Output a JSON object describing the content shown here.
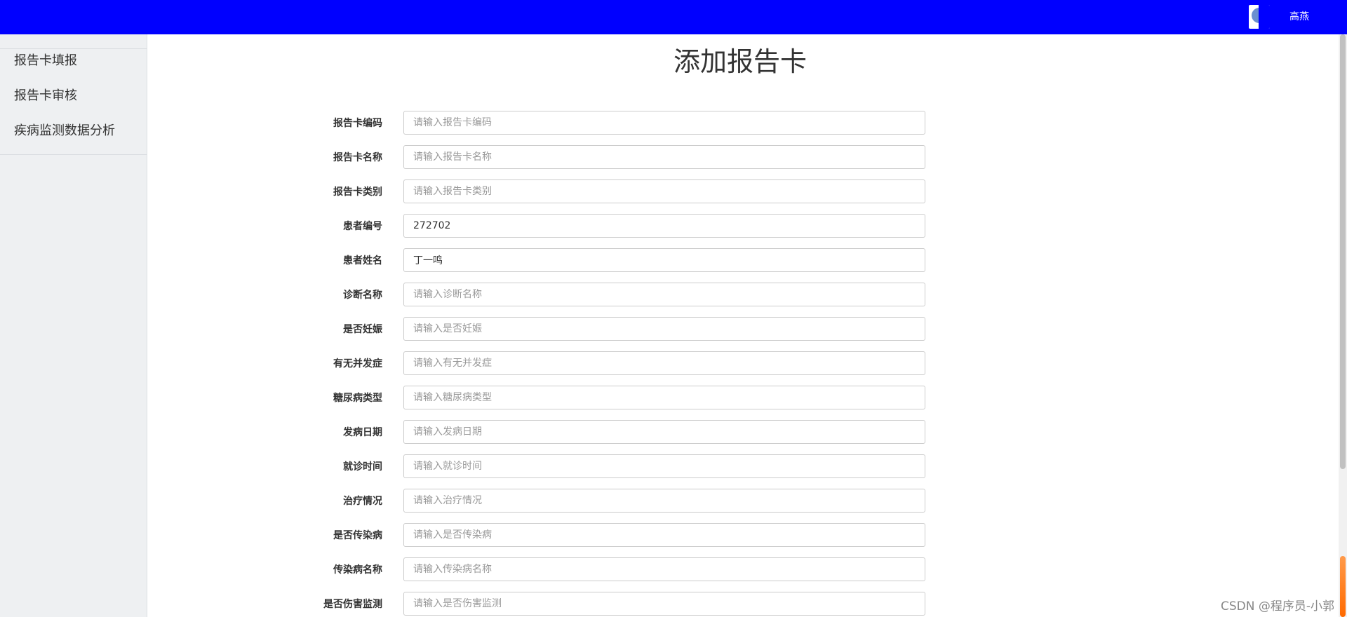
{
  "header": {
    "username": "高燕",
    "avatar_icon": "user-avatar-image",
    "bg_color": "#0000ff"
  },
  "sidebar": {
    "items": [
      {
        "label": "报告卡填报"
      },
      {
        "label": "报告卡审核"
      },
      {
        "label": "疾病监测数据分析"
      }
    ]
  },
  "main": {
    "title": "添加报告卡",
    "fields": [
      {
        "label": "报告卡编码",
        "value": "",
        "placeholder": "请输入报告卡编码"
      },
      {
        "label": "报告卡名称",
        "value": "",
        "placeholder": "请输入报告卡名称"
      },
      {
        "label": "报告卡类别",
        "value": "",
        "placeholder": "请输入报告卡类别"
      },
      {
        "label": "患者编号",
        "value": "272702",
        "placeholder": ""
      },
      {
        "label": "患者姓名",
        "value": "丁一鸣",
        "placeholder": ""
      },
      {
        "label": "诊断名称",
        "value": "",
        "placeholder": "请输入诊断名称"
      },
      {
        "label": "是否妊娠",
        "value": "",
        "placeholder": "请输入是否妊娠"
      },
      {
        "label": "有无并发症",
        "value": "",
        "placeholder": "请输入有无并发症"
      },
      {
        "label": "糖尿病类型",
        "value": "",
        "placeholder": "请输入糖尿病类型"
      },
      {
        "label": "发病日期",
        "value": "",
        "placeholder": "请输入发病日期"
      },
      {
        "label": "就诊时间",
        "value": "",
        "placeholder": "请输入就诊时间"
      },
      {
        "label": "治疗情况",
        "value": "",
        "placeholder": "请输入治疗情况"
      },
      {
        "label": "是否传染病",
        "value": "",
        "placeholder": "请输入是否传染病"
      },
      {
        "label": "传染病名称",
        "value": "",
        "placeholder": "请输入传染病名称"
      },
      {
        "label": "是否伤害监测",
        "value": "",
        "placeholder": "请输入是否伤害监测"
      }
    ]
  },
  "watermark": "CSDN @程序员-小郭"
}
